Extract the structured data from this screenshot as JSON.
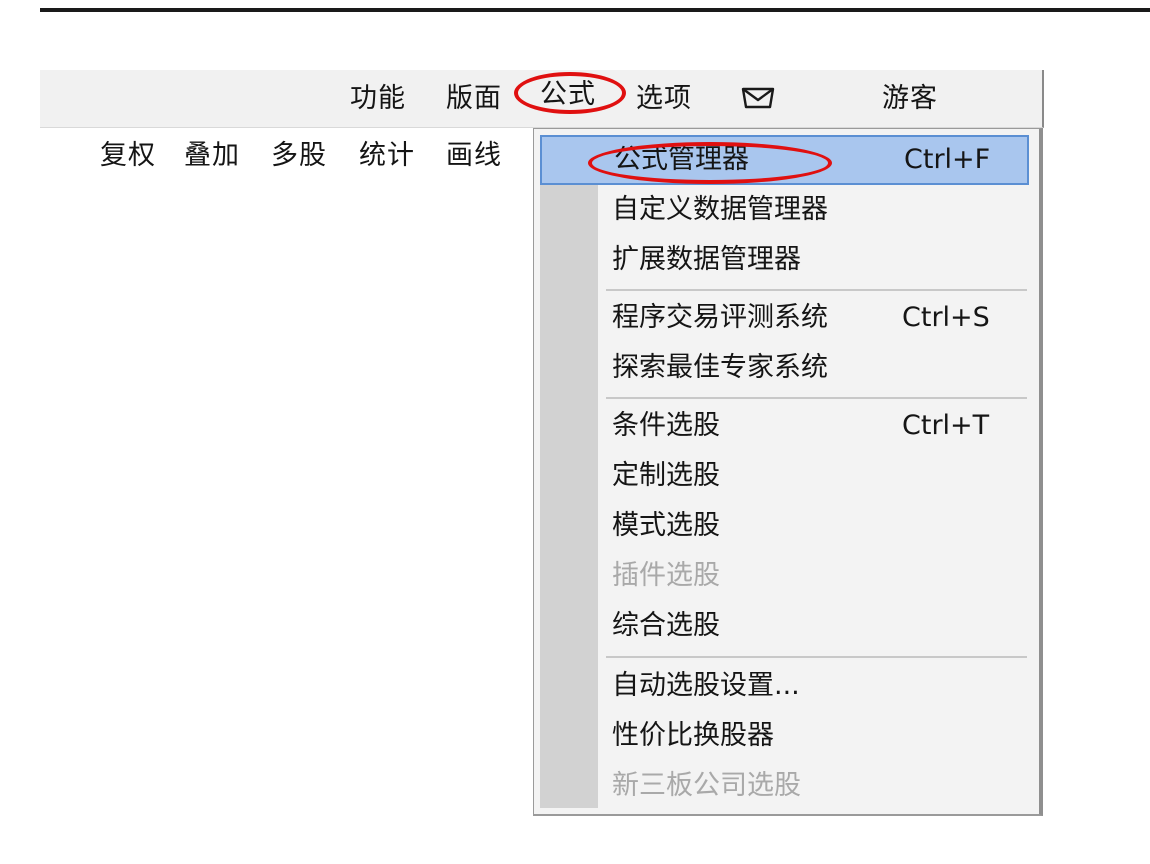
{
  "menubar": {
    "items": [
      "功能",
      "版面",
      "公式",
      "选项"
    ],
    "mail_icon": "envelope-icon",
    "user": "游客"
  },
  "toolbar": {
    "items": [
      "复权",
      "叠加",
      "多股",
      "统计",
      "画线"
    ]
  },
  "dropdown": {
    "items": [
      {
        "label": "公式管理器",
        "shortcut": "Ctrl+F",
        "state": "highlighted"
      },
      {
        "label": "自定义数据管理器",
        "shortcut": "",
        "state": "enabled"
      },
      {
        "label": "扩展数据管理器",
        "shortcut": "",
        "state": "enabled"
      },
      {
        "label": "程序交易评测系统",
        "shortcut": "Ctrl+S",
        "state": "enabled"
      },
      {
        "label": "探索最佳专家系统",
        "shortcut": "",
        "state": "enabled"
      },
      {
        "label": "条件选股",
        "shortcut": "Ctrl+T",
        "state": "enabled"
      },
      {
        "label": "定制选股",
        "shortcut": "",
        "state": "enabled"
      },
      {
        "label": "模式选股",
        "shortcut": "",
        "state": "enabled"
      },
      {
        "label": "插件选股",
        "shortcut": "",
        "state": "disabled"
      },
      {
        "label": "综合选股",
        "shortcut": "",
        "state": "enabled"
      },
      {
        "label": "自动选股设置...",
        "shortcut": "",
        "state": "enabled"
      },
      {
        "label": "性价比换股器",
        "shortcut": "",
        "state": "enabled"
      },
      {
        "label": "新三板公司选股",
        "shortcut": "",
        "state": "disabled"
      }
    ]
  },
  "colors": {
    "annotation_red": "#e01010",
    "highlight_blue": "#a9c6ee",
    "highlight_border": "#5b8fd3"
  }
}
